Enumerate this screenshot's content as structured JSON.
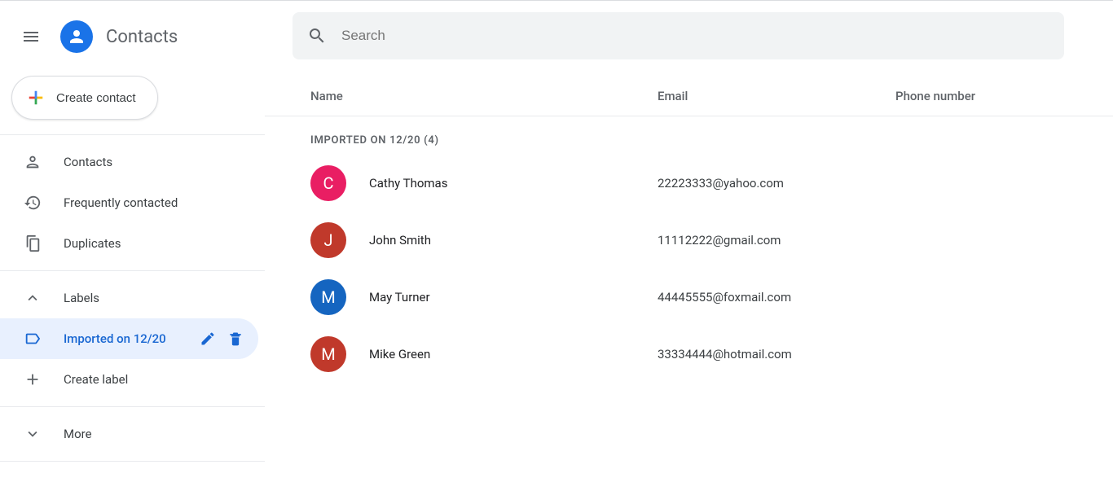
{
  "header": {
    "app_title": "Contacts"
  },
  "sidebar": {
    "create_label": "Create contact",
    "items": [
      {
        "label": "Contacts"
      },
      {
        "label": "Frequently contacted"
      },
      {
        "label": "Duplicates"
      }
    ],
    "labels_header": "Labels",
    "label_items": [
      {
        "label": "Imported on 12/20"
      }
    ],
    "create_label_label": "Create label",
    "more_label": "More"
  },
  "search": {
    "placeholder": "Search"
  },
  "table": {
    "columns": {
      "name": "Name",
      "email": "Email",
      "phone": "Phone number"
    },
    "section_title": "Imported on 12/20 (4)",
    "rows": [
      {
        "initial": "C",
        "name": "Cathy Thomas",
        "email": "22223333@yahoo.com",
        "phone": "",
        "color": "#e91e63"
      },
      {
        "initial": "J",
        "name": "John Smith",
        "email": "11112222@gmail.com",
        "phone": "",
        "color": "#c0392b"
      },
      {
        "initial": "M",
        "name": "May Turner",
        "email": "44445555@foxmail.com",
        "phone": "",
        "color": "#1565c0"
      },
      {
        "initial": "M",
        "name": "Mike Green",
        "email": "33334444@hotmail.com",
        "phone": "",
        "color": "#c0392b"
      }
    ]
  }
}
